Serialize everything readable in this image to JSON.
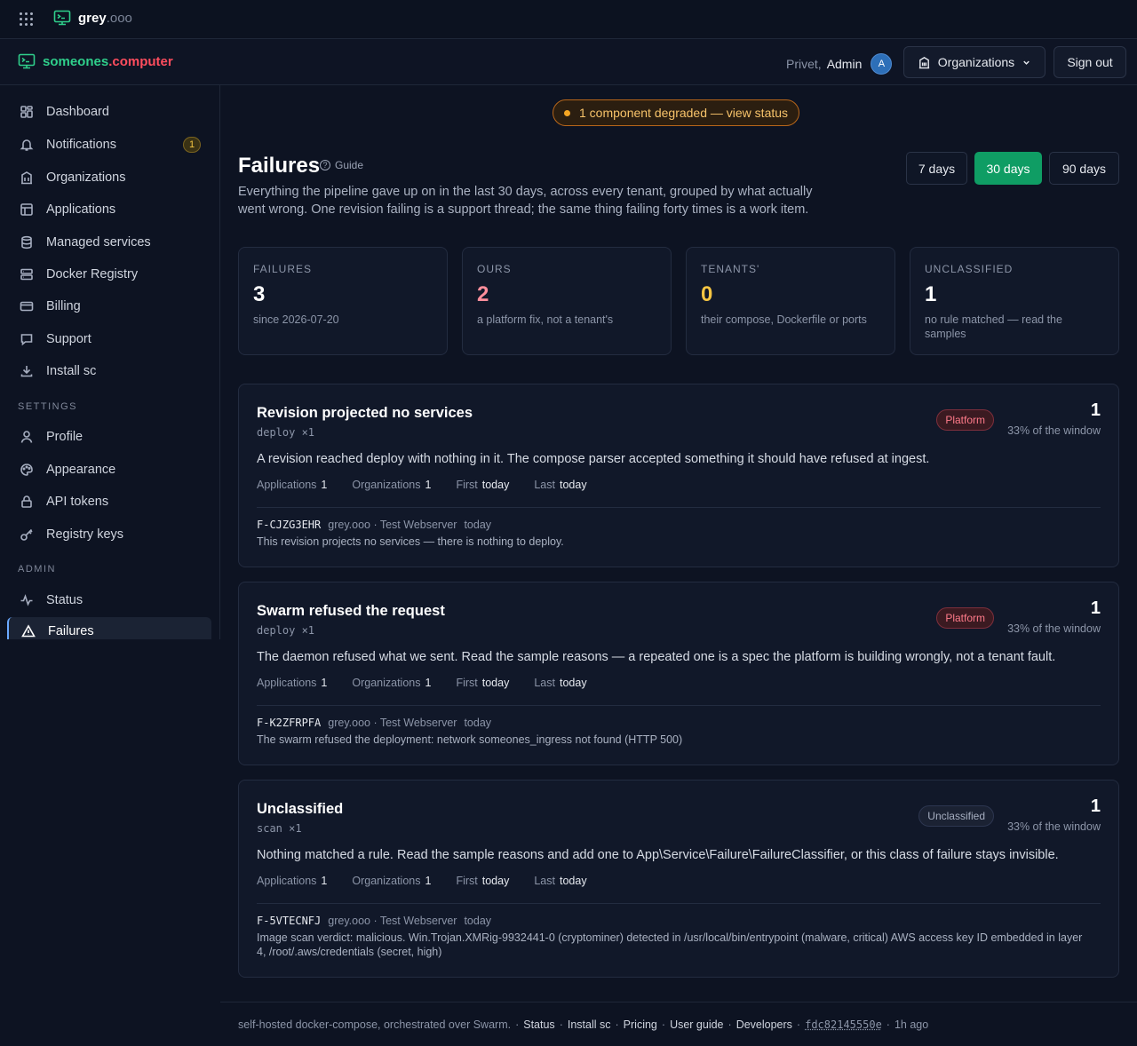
{
  "topbar": {
    "brand_name": "grey",
    "brand_tld": ".ooo"
  },
  "appbar": {
    "brand_left": "someones",
    "brand_right": ".computer",
    "greeting": "Privet,",
    "user_name": "Admin",
    "avatar_initial": "A",
    "organizations_label": "Organizations",
    "sign_out_label": "Sign out"
  },
  "sidebar": {
    "items": [
      {
        "label": "Dashboard",
        "icon": "dashboard-icon"
      },
      {
        "label": "Notifications",
        "icon": "bell-icon",
        "badge": "1"
      },
      {
        "label": "Organizations",
        "icon": "building-icon"
      },
      {
        "label": "Applications",
        "icon": "layout-icon"
      },
      {
        "label": "Managed services",
        "icon": "database-icon"
      },
      {
        "label": "Docker Registry",
        "icon": "server-icon"
      },
      {
        "label": "Billing",
        "icon": "credit-card-icon"
      },
      {
        "label": "Support",
        "icon": "chat-icon"
      },
      {
        "label": "Install sc",
        "icon": "download-icon"
      }
    ],
    "settings_heading": "SETTINGS",
    "settings_items": [
      {
        "label": "Profile",
        "icon": "user-icon"
      },
      {
        "label": "Appearance",
        "icon": "palette-icon"
      },
      {
        "label": "API tokens",
        "icon": "lock-icon"
      },
      {
        "label": "Registry keys",
        "icon": "key-icon"
      }
    ],
    "admin_heading": "ADMIN",
    "admin_items": [
      {
        "label": "Status",
        "icon": "activity-icon"
      },
      {
        "label": "Failures",
        "icon": "warning-icon",
        "active": true
      }
    ]
  },
  "main": {
    "status_banner": "1 component degraded — view status",
    "title": "Failures",
    "guide_label": "Guide",
    "description": "Everything the pipeline gave up on in the last 30 days, across every tenant, grouped by what actually went wrong. One revision failing is a support thread; the same thing failing forty times is a work item.",
    "ranges": [
      "7 days",
      "30 days",
      "90 days"
    ],
    "selected_range": "30 days",
    "stats": [
      {
        "label": "FAILURES",
        "value": "3",
        "sub": "since 2026-07-20",
        "color": "#ffffff"
      },
      {
        "label": "OURS",
        "value": "2",
        "sub": "a platform fix, not a tenant's",
        "color": "#ff8e9b"
      },
      {
        "label": "TENANTS'",
        "value": "0",
        "sub": "their compose, Dockerfile or ports",
        "color": "#f5c542"
      },
      {
        "label": "UNCLASSIFIED",
        "value": "1",
        "sub": "no rule matched — read the samples",
        "color": "#ffffff"
      }
    ],
    "groups": [
      {
        "title": "Revision projected no services",
        "tag": "deploy ×1",
        "badge": "Platform",
        "count": "1",
        "window": "33% of the window",
        "description": "A revision reached deploy with nothing in it. The compose parser accepted something it should have refused at ingest.",
        "meta": {
          "applications_label": "Applications",
          "applications": "1",
          "organizations_label": "Organizations",
          "organizations": "1",
          "first_label": "First",
          "first": "today",
          "last_label": "Last",
          "last": "today"
        },
        "sample": {
          "id": "F-CJZG3EHR",
          "org": "grey.ooo · Test Webserver",
          "when": "today",
          "message": "This revision projects no services — there is nothing to deploy."
        }
      },
      {
        "title": "Swarm refused the request",
        "tag": "deploy ×1",
        "badge": "Platform",
        "count": "1",
        "window": "33% of the window",
        "description": "The daemon refused what we sent. Read the sample reasons — a repeated one is a spec the platform is building wrongly, not a tenant fault.",
        "meta": {
          "applications_label": "Applications",
          "applications": "1",
          "organizations_label": "Organizations",
          "organizations": "1",
          "first_label": "First",
          "first": "today",
          "last_label": "Last",
          "last": "today"
        },
        "sample": {
          "id": "F-K2ZFRPFA",
          "org": "grey.ooo · Test Webserver",
          "when": "today",
          "message": "The swarm refused the deployment: network someones_ingress not found (HTTP 500)"
        }
      },
      {
        "title": "Unclassified",
        "tag": "scan ×1",
        "badge": "Unclassified",
        "count": "1",
        "window": "33% of the window",
        "description": "Nothing matched a rule. Read the sample reasons and add one to App\\Service\\Failure\\FailureClassifier, or this class of failure stays invisible.",
        "meta": {
          "applications_label": "Applications",
          "applications": "1",
          "organizations_label": "Organizations",
          "organizations": "1",
          "first_label": "First",
          "first": "today",
          "last_label": "Last",
          "last": "today"
        },
        "sample": {
          "id": "F-5VTECNFJ",
          "org": "grey.ooo · Test Webserver",
          "when": "today",
          "message": "Image scan verdict: malicious. Win.Trojan.XMRig-9932441-0 (cryptominer) detected in /usr/local/bin/entrypoint (malware, critical) AWS access key ID embedded in layer 4, /root/.aws/credentials (secret, high)"
        }
      }
    ]
  },
  "footer": {
    "tagline": "self-hosted docker-compose, orchestrated over Swarm.",
    "sep": "·",
    "links": [
      "Status",
      "Install sc",
      "Pricing",
      "User guide",
      "Developers"
    ],
    "commit": "fdc82145550e",
    "age": "1h ago"
  }
}
